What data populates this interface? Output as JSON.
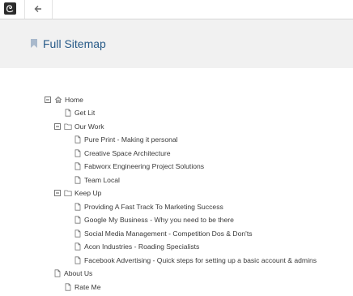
{
  "toolbar": {
    "logo_icon": "concrete-cms-logo",
    "back_icon": "arrow-left-icon"
  },
  "header": {
    "title": "Full Sitemap",
    "icon": "bookmark-icon"
  },
  "colors": {
    "title": "#275a88",
    "header_bg": "#f1f1f1",
    "text": "#3a3a3a",
    "icon": "#7a7a7a"
  },
  "sitemap": {
    "home": "Home",
    "get_lit": "Get Lit",
    "our_work": "Our Work",
    "our_work_items": [
      "Pure Print - Making it personal",
      "Creative Space Architecture",
      "Fabworx Engineering Project Solutions",
      "Team Local"
    ],
    "keep_up": "Keep Up",
    "keep_up_items": [
      "Providing A Fast Track To Marketing Success",
      "Google My Business - Why you need to be there",
      "Social Media Management - Competition Dos & Don'ts",
      "Acon Industries - Roading Specialists",
      "Facebook Advertising - Quick steps for setting up a basic account & admins"
    ],
    "about_us": "About Us",
    "rate_me": "Rate Me"
  }
}
